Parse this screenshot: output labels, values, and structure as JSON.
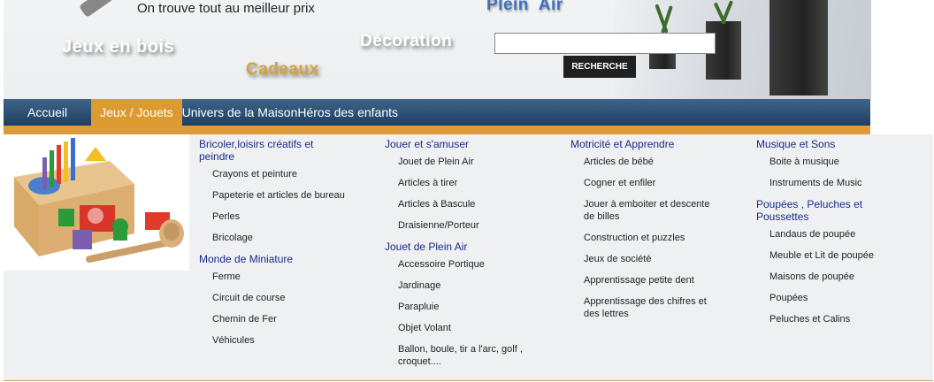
{
  "header": {
    "tagline": "On trouve tout au meilleur prix",
    "links": {
      "jeux_en_bois": "Jeux en bois",
      "cadeaux": "Cadeaux",
      "decoration": "Décoration",
      "plein_air": "Plein  Air"
    },
    "search": {
      "placeholder": "",
      "value": "",
      "button_label": "RECHERCHE"
    }
  },
  "nav": {
    "items": [
      {
        "label": "Accueil",
        "active": false
      },
      {
        "label": "Jeux / Jouets",
        "active": true
      },
      {
        "label": "Univers de la Maison",
        "active": false
      },
      {
        "label": "Héros des enfants",
        "active": false
      }
    ]
  },
  "menu": {
    "columns": [
      {
        "sections": [
          {
            "title": "Bricoler,loisirs créatifs et peindre",
            "items": [
              "Crayons et peinture",
              "Papeterie et articles de bureau",
              "Perles",
              "Bricolage"
            ]
          },
          {
            "title": "Monde de Miniature",
            "items": [
              "Ferme",
              "Circuit de course",
              "Chemin de Fer",
              "Véhicules"
            ]
          }
        ]
      },
      {
        "sections": [
          {
            "title": "Jouer et s'amuser",
            "items": [
              "Jouet de Plein Air",
              "Articles à tirer",
              "Articles à Bascule",
              "Draisienne/Porteur"
            ]
          },
          {
            "title": "Jouet de Plein Air",
            "items": [
              "Accessoire Portique",
              "Jardinage",
              "Parapluie",
              "Objet Volant",
              "Ballon, boule, tir a l'arc, golf , croquet...."
            ]
          }
        ]
      },
      {
        "sections": [
          {
            "title": "Motricité et Apprendre",
            "items": [
              "Articles de bébé",
              "Cogner et enfiler",
              "Jouer à emboiter et descente de billes",
              "Construction et puzzles",
              "Jeux de société",
              "Apprentissage petite dent",
              "Apprentissage des chifres et des lettres"
            ]
          }
        ]
      },
      {
        "sections": [
          {
            "title": "Musique et Sons",
            "items": [
              "Boite à musique",
              "Instruments de Music"
            ]
          },
          {
            "title": "Poupées , Peluches et Poussettes",
            "items": [
              "Landaus de poupée",
              "Meuble et Lit de poupée",
              "Maisons de poupée",
              "Poupées",
              "Peluches et Calins"
            ]
          }
        ]
      }
    ]
  },
  "colors": {
    "nav_bg": "#2a4c70",
    "nav_active": "#dc9a30",
    "category_title": "#1a2a8a",
    "accent_line": "#dd9a3a"
  }
}
